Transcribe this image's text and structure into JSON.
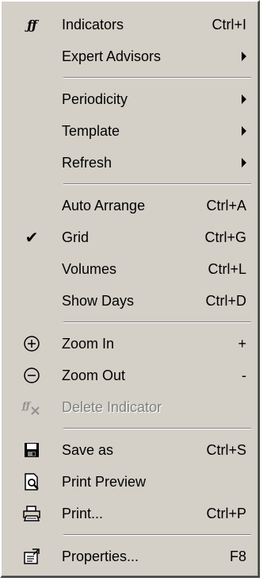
{
  "menu": {
    "items": [
      {
        "label": "Indicators",
        "shortcut": "Ctrl+I",
        "icon": "indicators-icon"
      },
      {
        "label": "Expert Advisors",
        "submenu": true
      },
      {
        "separator": true
      },
      {
        "label": "Periodicity",
        "submenu": true
      },
      {
        "label": "Template",
        "submenu": true
      },
      {
        "label": "Refresh",
        "submenu": true
      },
      {
        "separator": true
      },
      {
        "label": "Auto Arrange",
        "shortcut": "Ctrl+A"
      },
      {
        "label": "Grid",
        "shortcut": "Ctrl+G",
        "checked": true
      },
      {
        "label": "Volumes",
        "shortcut": "Ctrl+L"
      },
      {
        "label": "Show Days",
        "shortcut": "Ctrl+D"
      },
      {
        "separator": true
      },
      {
        "label": "Zoom In",
        "shortcut": "+",
        "icon": "zoom-in-icon"
      },
      {
        "label": "Zoom Out",
        "shortcut": "-",
        "icon": "zoom-out-icon"
      },
      {
        "label": "Delete Indicator",
        "disabled": true,
        "icon": "delete-indicator-icon"
      },
      {
        "separator": true
      },
      {
        "label": "Save as",
        "shortcut": "Ctrl+S",
        "icon": "save-icon"
      },
      {
        "label": "Print Preview",
        "icon": "print-preview-icon"
      },
      {
        "label": "Print...",
        "shortcut": "Ctrl+P",
        "icon": "printer-icon"
      },
      {
        "separator": true
      },
      {
        "label": "Properties...",
        "shortcut": "F8",
        "icon": "properties-icon"
      }
    ],
    "check_glyph": "✔",
    "indicator_glyph": "ƒƒ"
  }
}
